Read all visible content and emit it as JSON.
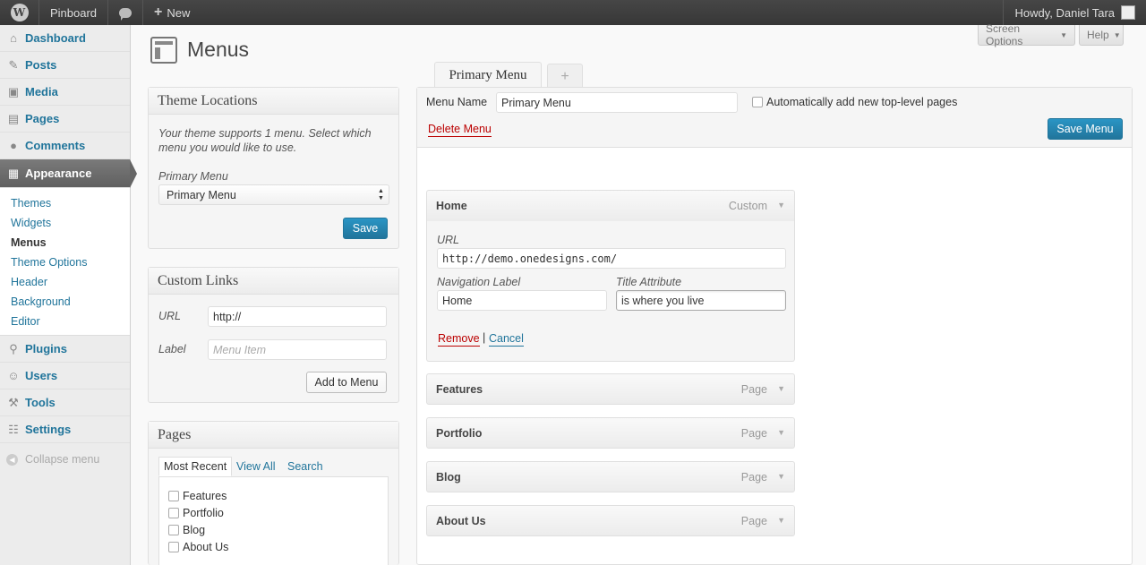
{
  "adminbar": {
    "site": "Pinboard",
    "new": "New",
    "howdy": "Howdy, Daniel Tara"
  },
  "sidebar": {
    "items_top": [
      {
        "label": "Dashboard",
        "icon": "home-icon"
      },
      {
        "label": "Posts",
        "icon": "pin-icon"
      },
      {
        "label": "Media",
        "icon": "media-icon"
      },
      {
        "label": "Pages",
        "icon": "pages-icon"
      },
      {
        "label": "Comments",
        "icon": "comments-icon"
      }
    ],
    "current": "Appearance",
    "submenu": [
      "Themes",
      "Widgets",
      "Menus",
      "Theme Options",
      "Header",
      "Background",
      "Editor"
    ],
    "active_sub": "Menus",
    "items_bottom": [
      {
        "label": "Plugins",
        "icon": "plugins-icon"
      },
      {
        "label": "Users",
        "icon": "users-icon"
      },
      {
        "label": "Tools",
        "icon": "tools-icon"
      },
      {
        "label": "Settings",
        "icon": "settings-icon"
      }
    ],
    "collapse": "Collapse menu"
  },
  "header": {
    "title": "Menus",
    "screen_options": "Screen Options",
    "help": "Help"
  },
  "theme_locations": {
    "title": "Theme Locations",
    "description": "Your theme supports 1 menu. Select which menu you would like to use.",
    "label": "Primary Menu",
    "selected": "Primary Menu",
    "save": "Save"
  },
  "custom_links": {
    "title": "Custom Links",
    "url_label": "URL",
    "url_value": "http://",
    "label_label": "Label",
    "label_placeholder": "Menu Item",
    "add_button": "Add to Menu"
  },
  "pages_box": {
    "title": "Pages",
    "tabs": [
      "Most Recent",
      "View All",
      "Search"
    ],
    "items": [
      "Features",
      "Portfolio",
      "Blog",
      "About Us"
    ]
  },
  "menu_tabs": {
    "active": "Primary Menu",
    "add": "+"
  },
  "menu_edit": {
    "name_label": "Menu Name",
    "name_value": "Primary Menu",
    "auto_add": "Automatically add new top-level pages",
    "delete": "Delete Menu",
    "save": "Save Menu"
  },
  "menu_items": [
    {
      "title": "Home",
      "type": "Custom"
    },
    {
      "title": "Features",
      "type": "Page"
    },
    {
      "title": "Portfolio",
      "type": "Page"
    },
    {
      "title": "Blog",
      "type": "Page"
    },
    {
      "title": "About Us",
      "type": "Page"
    }
  ],
  "item_settings": {
    "url_label": "URL",
    "url_value": "http://demo.onedesigns.com/",
    "nav_label": "Navigation Label",
    "nav_value": "Home",
    "title_label": "Title Attribute",
    "title_value": "is where you live",
    "remove": "Remove",
    "separator": "|",
    "cancel": "Cancel"
  }
}
